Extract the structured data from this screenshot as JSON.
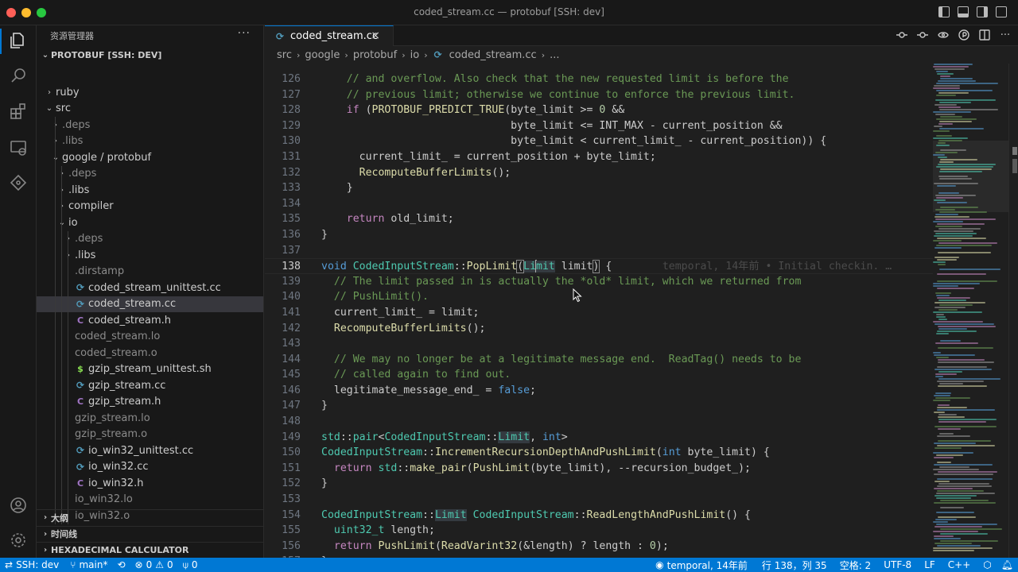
{
  "window": {
    "title": "coded_stream.cc — protobuf [SSH: dev]"
  },
  "sidebar": {
    "header": "资源管理器",
    "root": "PROTOBUF [SSH: DEV]",
    "tree": [
      {
        "label": "ruby",
        "depth": 1,
        "kind": "folder",
        "open": false,
        "dim": false
      },
      {
        "label": "src",
        "depth": 1,
        "kind": "folder",
        "open": true,
        "dim": false
      },
      {
        "label": ".deps",
        "depth": 2,
        "kind": "folder",
        "open": false,
        "dim": true
      },
      {
        "label": ".libs",
        "depth": 2,
        "kind": "folder",
        "open": false,
        "dim": true
      },
      {
        "label": "google / protobuf",
        "depth": 2,
        "kind": "folder",
        "open": true,
        "dim": false
      },
      {
        "label": ".deps",
        "depth": 3,
        "kind": "folder",
        "open": false,
        "dim": true
      },
      {
        "label": ".libs",
        "depth": 3,
        "kind": "folder",
        "open": false,
        "dim": false
      },
      {
        "label": "compiler",
        "depth": 3,
        "kind": "folder",
        "open": false,
        "dim": false
      },
      {
        "label": "io",
        "depth": 3,
        "kind": "folder",
        "open": true,
        "dim": false
      },
      {
        "label": ".deps",
        "depth": 4,
        "kind": "folder",
        "open": false,
        "dim": true
      },
      {
        "label": ".libs",
        "depth": 4,
        "kind": "folder",
        "open": false,
        "dim": false
      },
      {
        "label": ".dirstamp",
        "depth": 4,
        "kind": "file",
        "icon": "none",
        "dim": true
      },
      {
        "label": "coded_stream_unittest.cc",
        "depth": 4,
        "kind": "file",
        "icon": "cc",
        "dim": false
      },
      {
        "label": "coded_stream.cc",
        "depth": 4,
        "kind": "file",
        "icon": "cc",
        "dim": false,
        "selected": true
      },
      {
        "label": "coded_stream.h",
        "depth": 4,
        "kind": "file",
        "icon": "h",
        "dim": false
      },
      {
        "label": "coded_stream.lo",
        "depth": 4,
        "kind": "file",
        "icon": "none",
        "dim": true
      },
      {
        "label": "coded_stream.o",
        "depth": 4,
        "kind": "file",
        "icon": "none",
        "dim": true
      },
      {
        "label": "gzip_stream_unittest.sh",
        "depth": 4,
        "kind": "file",
        "icon": "sh",
        "dim": false
      },
      {
        "label": "gzip_stream.cc",
        "depth": 4,
        "kind": "file",
        "icon": "cc",
        "dim": false
      },
      {
        "label": "gzip_stream.h",
        "depth": 4,
        "kind": "file",
        "icon": "h",
        "dim": false
      },
      {
        "label": "gzip_stream.lo",
        "depth": 4,
        "kind": "file",
        "icon": "none",
        "dim": true
      },
      {
        "label": "gzip_stream.o",
        "depth": 4,
        "kind": "file",
        "icon": "none",
        "dim": true
      },
      {
        "label": "io_win32_unittest.cc",
        "depth": 4,
        "kind": "file",
        "icon": "cc",
        "dim": false
      },
      {
        "label": "io_win32.cc",
        "depth": 4,
        "kind": "file",
        "icon": "cc",
        "dim": false
      },
      {
        "label": "io_win32.h",
        "depth": 4,
        "kind": "file",
        "icon": "h",
        "dim": false
      },
      {
        "label": "io_win32.lo",
        "depth": 4,
        "kind": "file",
        "icon": "none",
        "dim": true
      },
      {
        "label": "io_win32.o",
        "depth": 4,
        "kind": "file",
        "icon": "none",
        "dim": true
      }
    ],
    "sections": [
      "大纲",
      "时间线",
      "HEXADECIMAL CALCULATOR"
    ]
  },
  "editor": {
    "tab_label": "coded_stream.cc",
    "breadcrumb": [
      "src",
      "google",
      "protobuf",
      "io",
      "coded_stream.cc",
      "..."
    ],
    "lines": [
      {
        "n": "126",
        "tokens": [
          [
            "    ",
            ""
          ],
          [
            "// and overflow. Also check that the new requested limit is before the",
            "cmt"
          ]
        ]
      },
      {
        "n": "127",
        "tokens": [
          [
            "    ",
            ""
          ],
          [
            "// previous limit; otherwise we continue to enforce the previous limit.",
            "cmt"
          ]
        ]
      },
      {
        "n": "128",
        "tokens": [
          [
            "    ",
            ""
          ],
          [
            "if",
            "ctrl"
          ],
          [
            " (",
            ""
          ],
          [
            "PROTOBUF_PREDICT_TRUE",
            "fn"
          ],
          [
            "(byte_limit >= ",
            ""
          ],
          [
            "0",
            "num"
          ],
          [
            " &&",
            ""
          ]
        ]
      },
      {
        "n": "129",
        "tokens": [
          [
            "                              byte_limit <= INT_MAX - current_position &&",
            ""
          ]
        ]
      },
      {
        "n": "130",
        "tokens": [
          [
            "                              byte_limit < current_limit_ - current_position)) {",
            ""
          ]
        ]
      },
      {
        "n": "131",
        "tokens": [
          [
            "      current_limit_ = current_position + byte_limit;",
            ""
          ]
        ]
      },
      {
        "n": "132",
        "tokens": [
          [
            "      ",
            ""
          ],
          [
            "RecomputeBufferLimits",
            "fn"
          ],
          [
            "();",
            ""
          ]
        ]
      },
      {
        "n": "133",
        "tokens": [
          [
            "    }",
            ""
          ]
        ]
      },
      {
        "n": "134",
        "tokens": []
      },
      {
        "n": "135",
        "tokens": [
          [
            "    ",
            ""
          ],
          [
            "return",
            "ctrl"
          ],
          [
            " old_limit;",
            ""
          ]
        ]
      },
      {
        "n": "136",
        "tokens": [
          [
            "}",
            ""
          ]
        ]
      },
      {
        "n": "137",
        "tokens": []
      },
      {
        "n": "138",
        "current": true,
        "tokens": [
          [
            "void",
            "kw"
          ],
          [
            " ",
            ""
          ],
          [
            "CodedInputStream",
            "type"
          ],
          [
            "::",
            ""
          ],
          [
            "PopLimit",
            "fn"
          ],
          [
            "(",
            "br"
          ],
          [
            "Li",
            "type-hl"
          ],
          [
            "|",
            "cursor"
          ],
          [
            "mit",
            "type-hl"
          ],
          [
            " limit",
            ""
          ],
          [
            ")",
            "br"
          ],
          [
            " {",
            ""
          ],
          [
            "        temporal, 14年前 • Initial checkin. …",
            "blame"
          ]
        ]
      },
      {
        "n": "139",
        "tokens": [
          [
            "  ",
            ""
          ],
          [
            "// The limit passed in is actually the *old* limit, which we returned from",
            "cmt"
          ]
        ]
      },
      {
        "n": "140",
        "tokens": [
          [
            "  ",
            ""
          ],
          [
            "// PushLimit().",
            "cmt"
          ]
        ]
      },
      {
        "n": "141",
        "tokens": [
          [
            "  current_limit_ = limit;",
            ""
          ]
        ]
      },
      {
        "n": "142",
        "tokens": [
          [
            "  ",
            ""
          ],
          [
            "RecomputeBufferLimits",
            "fn"
          ],
          [
            "();",
            ""
          ]
        ]
      },
      {
        "n": "143",
        "tokens": []
      },
      {
        "n": "144",
        "tokens": [
          [
            "  ",
            ""
          ],
          [
            "// We may no longer be at a legitimate message end.  ReadTag() needs to be",
            "cmt"
          ]
        ]
      },
      {
        "n": "145",
        "tokens": [
          [
            "  ",
            ""
          ],
          [
            "// called again to find out.",
            "cmt"
          ]
        ]
      },
      {
        "n": "146",
        "tokens": [
          [
            "  legitimate_message_end_ = ",
            ""
          ],
          [
            "false",
            "kw"
          ],
          [
            ";",
            ""
          ]
        ]
      },
      {
        "n": "147",
        "tokens": [
          [
            "}",
            ""
          ]
        ]
      },
      {
        "n": "148",
        "tokens": []
      },
      {
        "n": "149",
        "tokens": [
          [
            "std",
            "type"
          ],
          [
            "::",
            ""
          ],
          [
            "pair",
            "type"
          ],
          [
            "<",
            ""
          ],
          [
            "CodedInputStream",
            "type"
          ],
          [
            "::",
            ""
          ],
          [
            "Limit",
            "type-hl"
          ],
          [
            ", ",
            ""
          ],
          [
            "int",
            "kw"
          ],
          [
            ">",
            ""
          ]
        ]
      },
      {
        "n": "150",
        "tokens": [
          [
            "CodedInputStream",
            "type"
          ],
          [
            "::",
            ""
          ],
          [
            "IncrementRecursionDepthAndPushLimit",
            "fn"
          ],
          [
            "(",
            ""
          ],
          [
            "int",
            "kw"
          ],
          [
            " byte_limit) {",
            ""
          ]
        ]
      },
      {
        "n": "151",
        "tokens": [
          [
            "  ",
            ""
          ],
          [
            "return",
            "ctrl"
          ],
          [
            " ",
            ""
          ],
          [
            "std",
            "type"
          ],
          [
            "::",
            ""
          ],
          [
            "make_pair",
            "fn"
          ],
          [
            "(",
            ""
          ],
          [
            "PushLimit",
            "fn"
          ],
          [
            "(byte_limit), --recursion_budget_);",
            ""
          ]
        ]
      },
      {
        "n": "152",
        "tokens": [
          [
            "}",
            ""
          ]
        ]
      },
      {
        "n": "153",
        "tokens": []
      },
      {
        "n": "154",
        "tokens": [
          [
            "CodedInputStream",
            "type"
          ],
          [
            "::",
            ""
          ],
          [
            "Limit",
            "type-hl"
          ],
          [
            " ",
            ""
          ],
          [
            "CodedInputStream",
            "type"
          ],
          [
            "::",
            ""
          ],
          [
            "ReadLengthAndPushLimit",
            "fn"
          ],
          [
            "() {",
            ""
          ]
        ]
      },
      {
        "n": "155",
        "tokens": [
          [
            "  ",
            ""
          ],
          [
            "uint32_t",
            "type"
          ],
          [
            " length;",
            ""
          ]
        ]
      },
      {
        "n": "156",
        "tokens": [
          [
            "  ",
            ""
          ],
          [
            "return",
            "ctrl"
          ],
          [
            " ",
            ""
          ],
          [
            "PushLimit",
            "fn"
          ],
          [
            "(",
            ""
          ],
          [
            "ReadVarint32",
            "fn"
          ],
          [
            "(&length) ? length : ",
            ""
          ],
          [
            "0",
            "num"
          ],
          [
            ");",
            ""
          ]
        ]
      },
      {
        "n": "157",
        "tokens": [
          [
            "}",
            ""
          ]
        ]
      }
    ]
  },
  "statusbar": {
    "remote": "SSH: dev",
    "branch": "main*",
    "errors": "0",
    "warnings": "0",
    "ports": "0",
    "blame": "temporal, 14年前",
    "position": "行 138，列 35",
    "indent": "空格: 2",
    "encoding": "UTF-8",
    "eol": "LF",
    "language": "C++"
  },
  "colors": {
    "accent": "#0078d4",
    "statusbar": "#0078d4",
    "comment": "#6a9955",
    "keyword": "#569cd6",
    "type": "#4ec9b0",
    "function": "#dcdcaa"
  }
}
